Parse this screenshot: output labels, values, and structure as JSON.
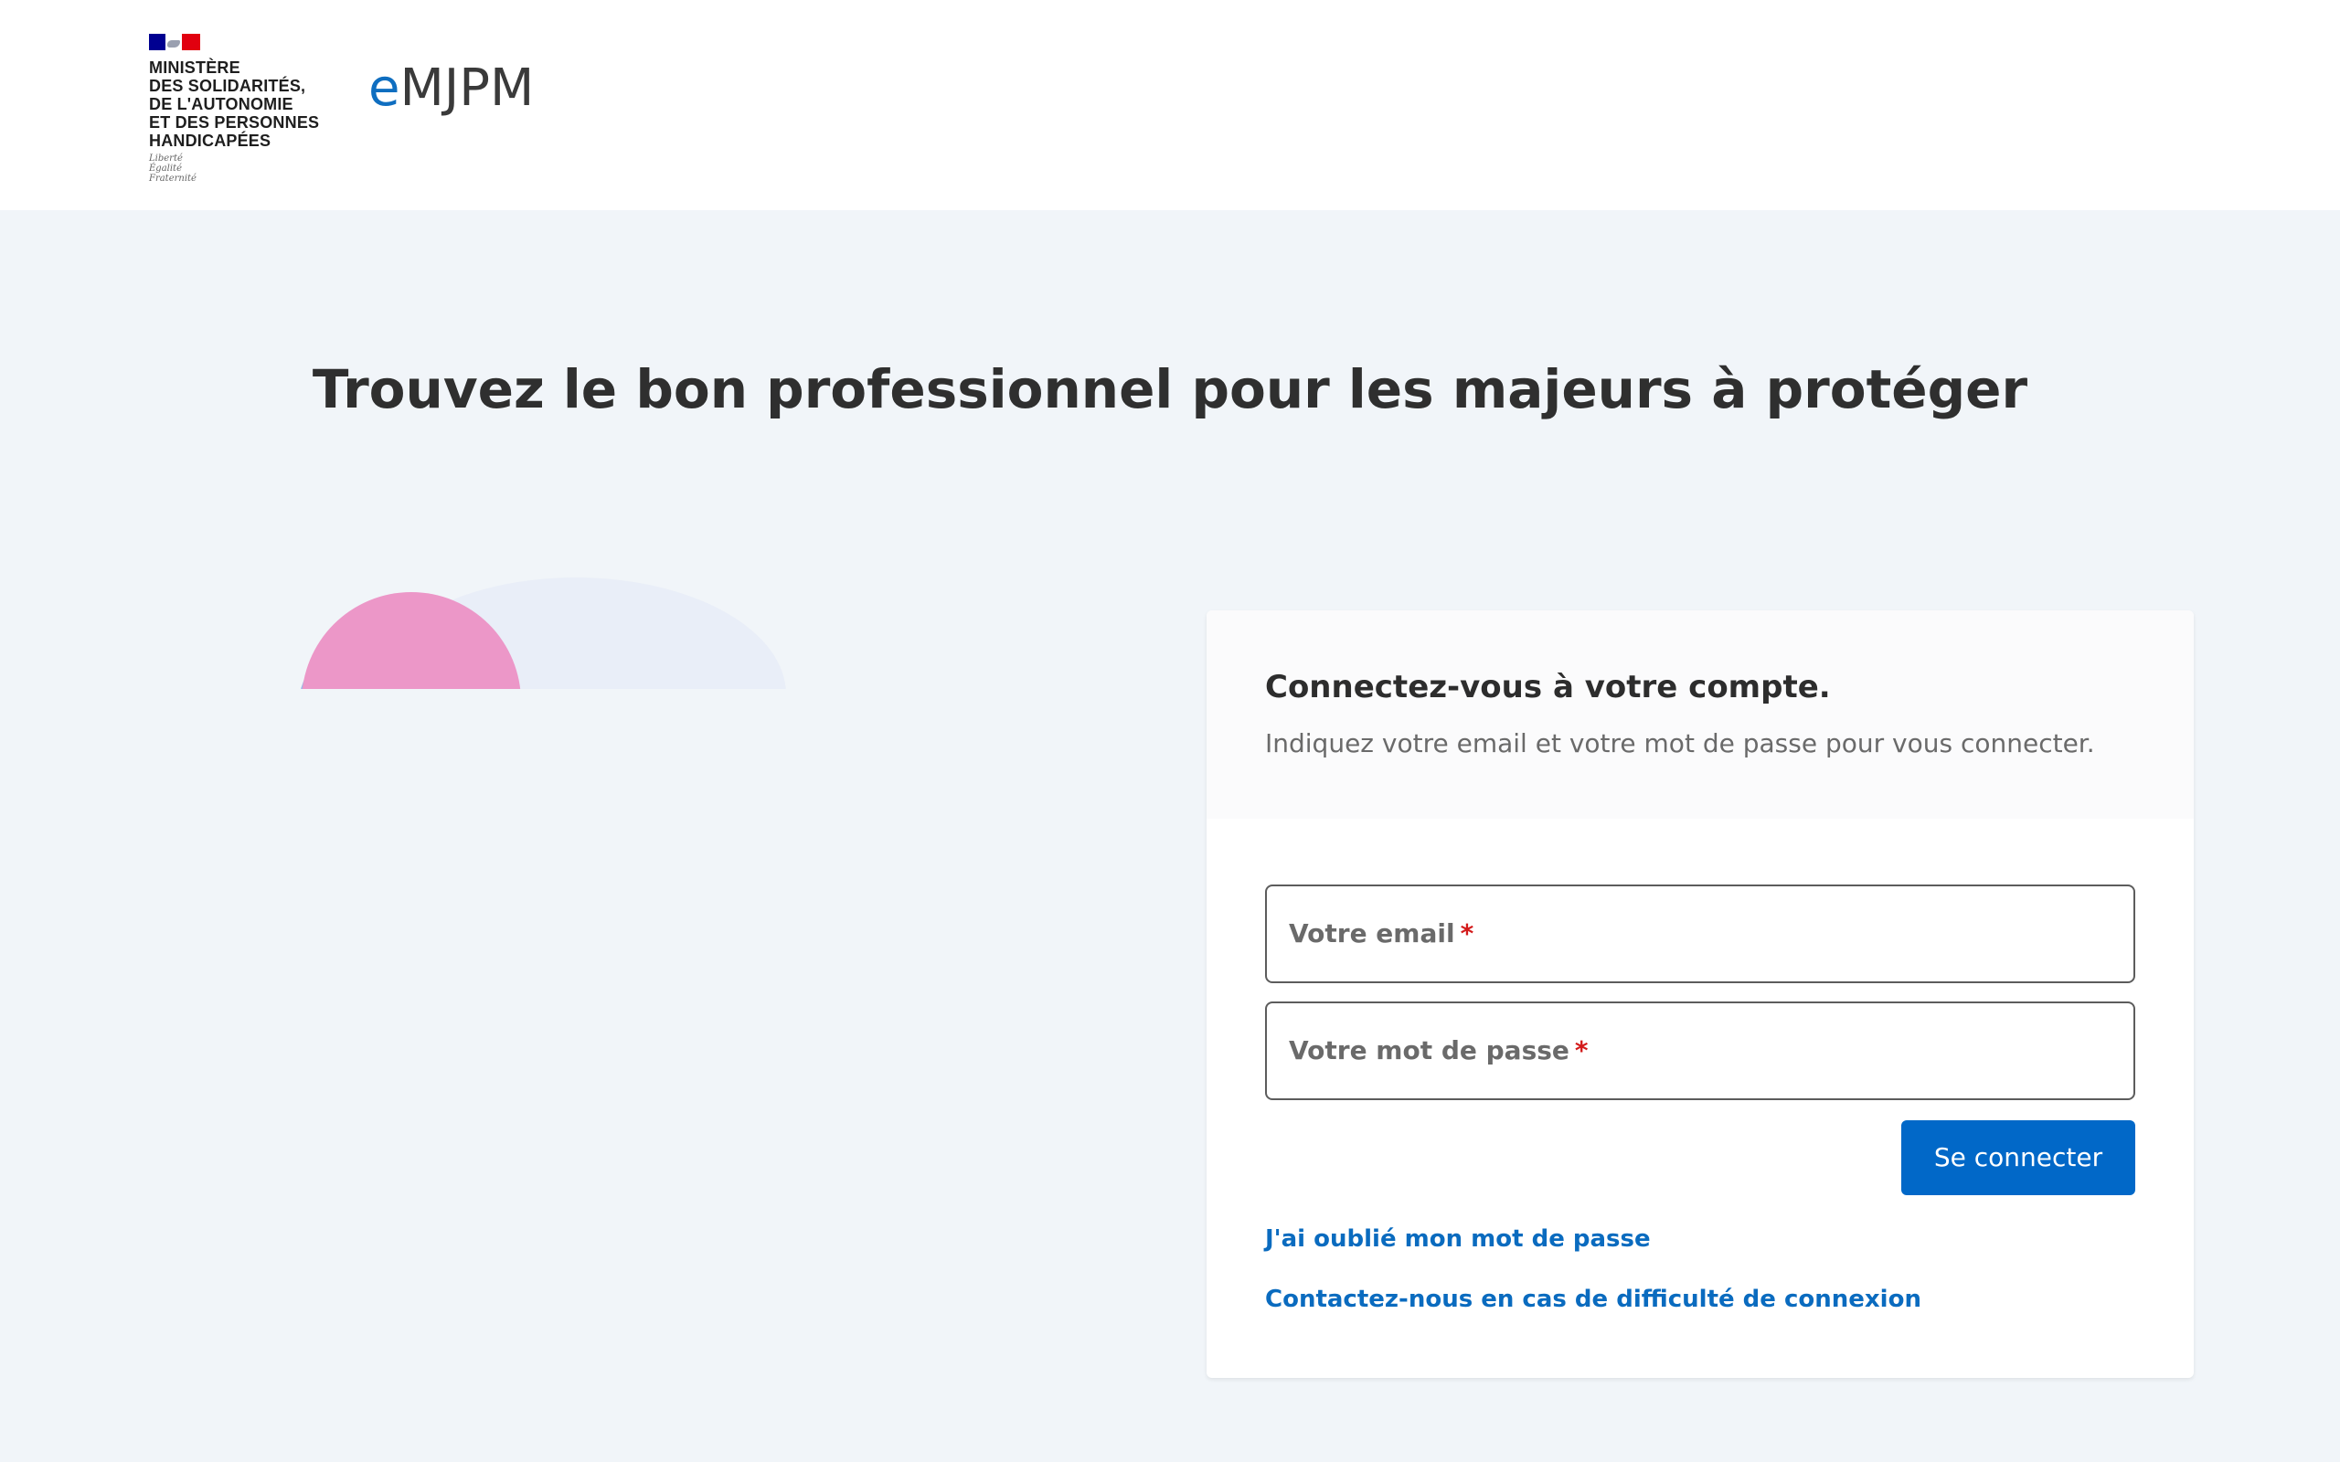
{
  "header": {
    "ministry_lines": "MINISTÈRE\nDES SOLIDARITÉS,\nDE L'AUTONOMIE\nET DES PERSONNES\nHANDICAPÉES",
    "devise": "Liberté\nÉgalité\nFraternité",
    "brand_prefix": "e",
    "brand_rest": "MJPM"
  },
  "hero": {
    "title": "Trouvez le bon professionnel pour les majeurs à protéger"
  },
  "login": {
    "title": "Connectez-vous à votre compte.",
    "subtitle": "Indiquez votre email et votre mot de passe pour vous connecter.",
    "email_label": "Votre email",
    "password_label": "Votre mot de passe",
    "required_mark": "*",
    "submit_label": "Se connecter",
    "forgot_link": "J'ai oublié mon mot de passe",
    "contact_link": "Contactez-nous en cas de difficulté de connexion"
  },
  "colors": {
    "brand_blue": "#0f6ec0",
    "button_blue": "#0168c8",
    "required_red": "#d31a1a",
    "page_background": "#f1f5f9",
    "illustration_pink": "#ec97c8"
  }
}
